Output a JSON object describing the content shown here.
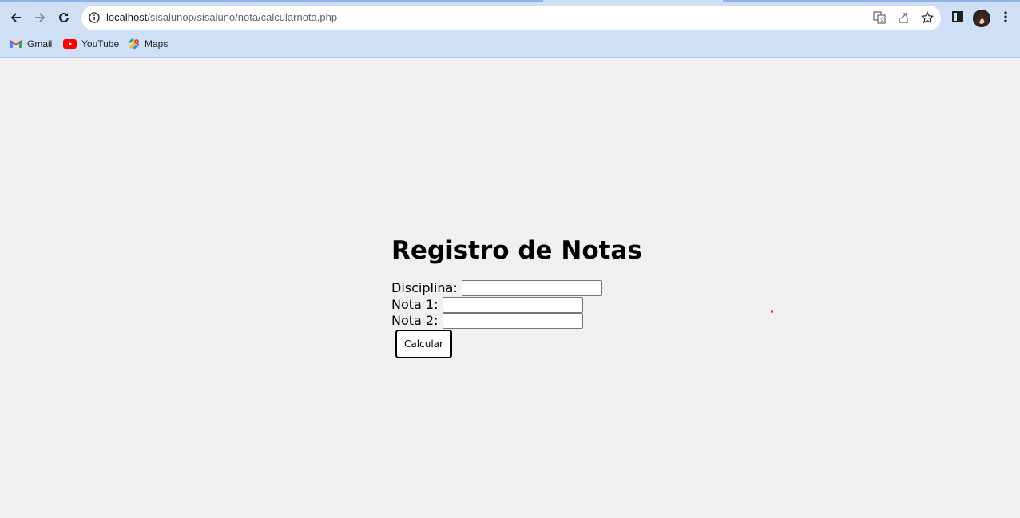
{
  "browser": {
    "url_host": "localhost",
    "url_path": "/sisalunop/sisaluno/nota/calcularnota.php",
    "bookmarks": [
      {
        "label": "Gmail",
        "icon": "gmail-icon"
      },
      {
        "label": "YouTube",
        "icon": "youtube-icon"
      },
      {
        "label": "Maps",
        "icon": "maps-icon"
      }
    ]
  },
  "page": {
    "title": "Registro de Notas",
    "fields": [
      {
        "label": "Disciplina:",
        "value": ""
      },
      {
        "label": "Nota 1:",
        "value": ""
      },
      {
        "label": "Nota 2:",
        "value": ""
      }
    ],
    "submit_label": "Calcular"
  },
  "colors": {
    "chrome_bg": "#cfe0f6",
    "page_bg": "#f0f0f0"
  }
}
